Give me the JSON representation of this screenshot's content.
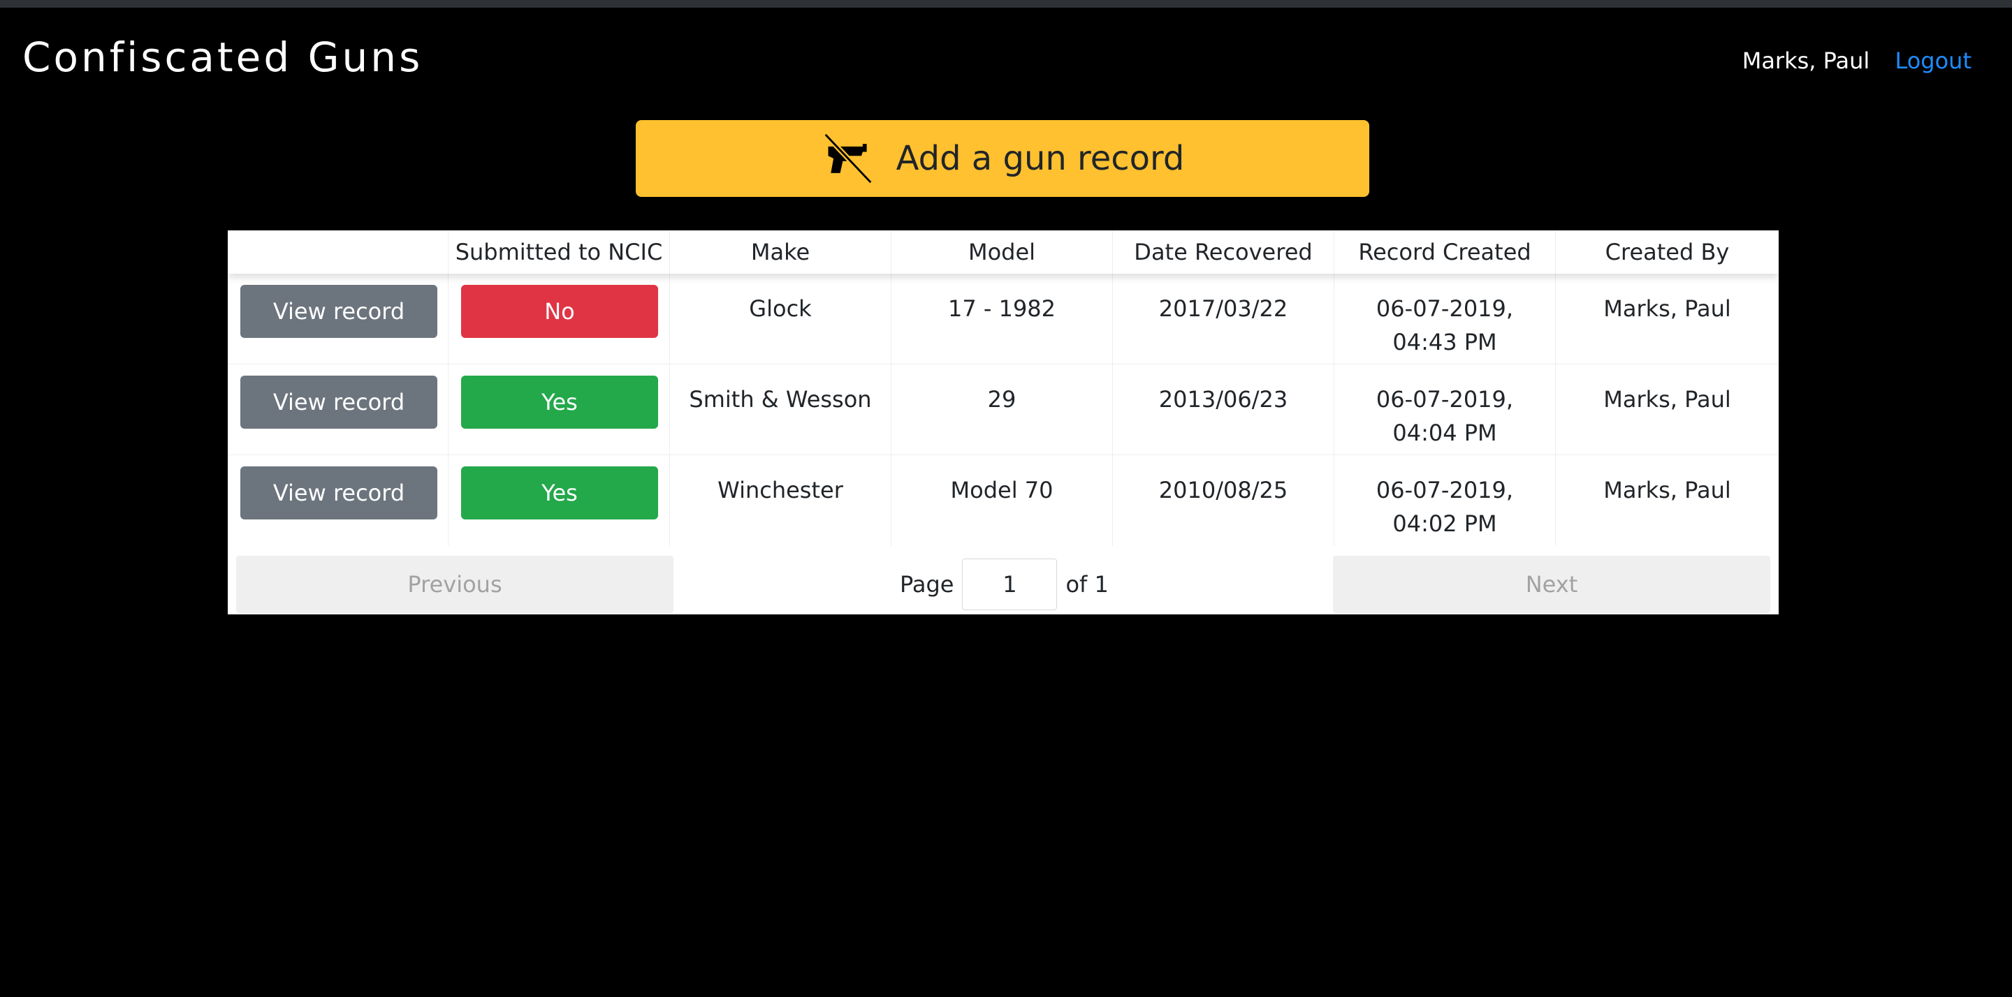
{
  "app": {
    "title": "Confiscated Guns"
  },
  "user": {
    "name": "Marks, Paul",
    "logout_label": "Logout"
  },
  "add_button": {
    "label": "Add a gun record",
    "icon": "no-gun-icon"
  },
  "table": {
    "headers": [
      "",
      "Submitted to NCIC",
      "Make",
      "Model",
      "Date Recovered",
      "Record Created",
      "Created By"
    ],
    "rows": [
      {
        "view_label": "View record",
        "ncic": "No",
        "make": "Glock",
        "model": "17 - 1982",
        "date_recovered": "2017/03/22",
        "record_created": "06-07-2019, 04:43 PM",
        "created_by": "Marks, Paul"
      },
      {
        "view_label": "View record",
        "ncic": "Yes",
        "make": "Smith & Wesson",
        "model": "29",
        "date_recovered": "2013/06/23",
        "record_created": "06-07-2019, 04:04 PM",
        "created_by": "Marks, Paul"
      },
      {
        "view_label": "View record",
        "ncic": "Yes",
        "make": "Winchester",
        "model": "Model 70",
        "date_recovered": "2010/08/25",
        "record_created": "06-07-2019, 04:02 PM",
        "created_by": "Marks, Paul"
      }
    ]
  },
  "pagination": {
    "previous_label": "Previous",
    "next_label": "Next",
    "page_label": "Page",
    "current_page": "1",
    "of_label": "of 1"
  },
  "colors": {
    "accent": "#ffc12f",
    "ncic_no": "#e03444",
    "ncic_yes": "#23a84a",
    "view_button": "#6c757d",
    "link": "#1e8cff"
  }
}
